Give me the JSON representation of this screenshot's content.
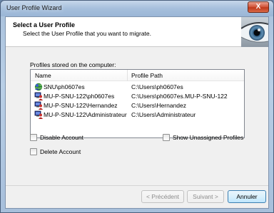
{
  "window": {
    "title": "User Profile Wizard",
    "close_glyph": "X"
  },
  "header": {
    "title": "Select a User Profile",
    "subtitle": "Select the User Profile that you want to migrate."
  },
  "profiles": {
    "label": "Profiles stored on the computer:",
    "columns": {
      "name": "Name",
      "path": "Profile Path"
    },
    "rows": [
      {
        "name": "SNU\\ph0607es",
        "path": "C:\\Users\\ph0607es",
        "icon": "domain-user-icon"
      },
      {
        "name": "MU-P-SNU-122\\ph0607es",
        "path": "C:\\Users\\ph0607es.MU-P-SNU-122",
        "icon": "local-user-icon"
      },
      {
        "name": "MU-P-SNU-122\\Hernandez",
        "path": "C:\\Users\\Hernandez",
        "icon": "local-user-icon"
      },
      {
        "name": "MU-P-SNU-122\\Administrateur",
        "path": "C:\\Users\\Administrateur",
        "icon": "local-user-icon"
      }
    ]
  },
  "options": {
    "disable_account": {
      "label": "Disable Account",
      "checked": false
    },
    "delete_account": {
      "label": "Delete Account",
      "checked": false
    },
    "show_unassigned": {
      "label": "Show Unassigned Profiles",
      "checked": false
    }
  },
  "buttons": {
    "back": "< Précédent",
    "next": "Suivant >",
    "cancel": "Annuler"
  },
  "colors": {
    "accent": "#3c7fb1",
    "disabled_text": "#8c8c8c"
  }
}
